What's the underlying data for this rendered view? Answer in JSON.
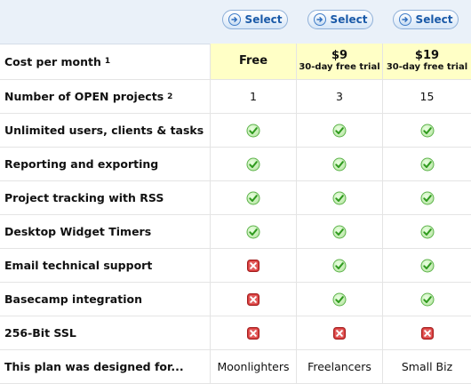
{
  "select_buttons": [
    {
      "label": "Select"
    },
    {
      "label": "Select"
    },
    {
      "label": "Select"
    }
  ],
  "plans": [
    {
      "price": "Free",
      "trial": ""
    },
    {
      "price": "$9",
      "trial": "30-day free trial"
    },
    {
      "price": "$19",
      "trial": "30-day free trial"
    }
  ],
  "rows": [
    {
      "label": "Cost per month",
      "footnote": "1"
    },
    {
      "label": "Number of OPEN projects",
      "footnote": "2",
      "values": [
        "1",
        "3",
        "15"
      ]
    },
    {
      "label": "Unlimited users, clients & tasks",
      "checks": [
        "yes",
        "yes",
        "yes"
      ]
    },
    {
      "label": "Reporting and exporting",
      "checks": [
        "yes",
        "yes",
        "yes"
      ]
    },
    {
      "label": "Project tracking with RSS",
      "checks": [
        "yes",
        "yes",
        "yes"
      ]
    },
    {
      "label": "Desktop Widget Timers",
      "checks": [
        "yes",
        "yes",
        "yes"
      ]
    },
    {
      "label": "Email technical support",
      "checks": [
        "no",
        "yes",
        "yes"
      ]
    },
    {
      "label": "Basecamp integration",
      "checks": [
        "no",
        "yes",
        "yes"
      ]
    },
    {
      "label": "256-Bit SSL",
      "checks": [
        "no",
        "no",
        "no"
      ]
    },
    {
      "label": "This plan was designed for...",
      "values": [
        "Moonlighters",
        "Freelancers",
        "Small Biz"
      ]
    }
  ],
  "colors": {
    "accent": "#1a5aa8",
    "check_green": "#3aa12e",
    "cross_red": "#cc2b2b",
    "highlight": "#ffffc6"
  },
  "icons": {
    "yes": "check-icon",
    "no": "cross-icon",
    "select": "arrow-right-icon"
  }
}
